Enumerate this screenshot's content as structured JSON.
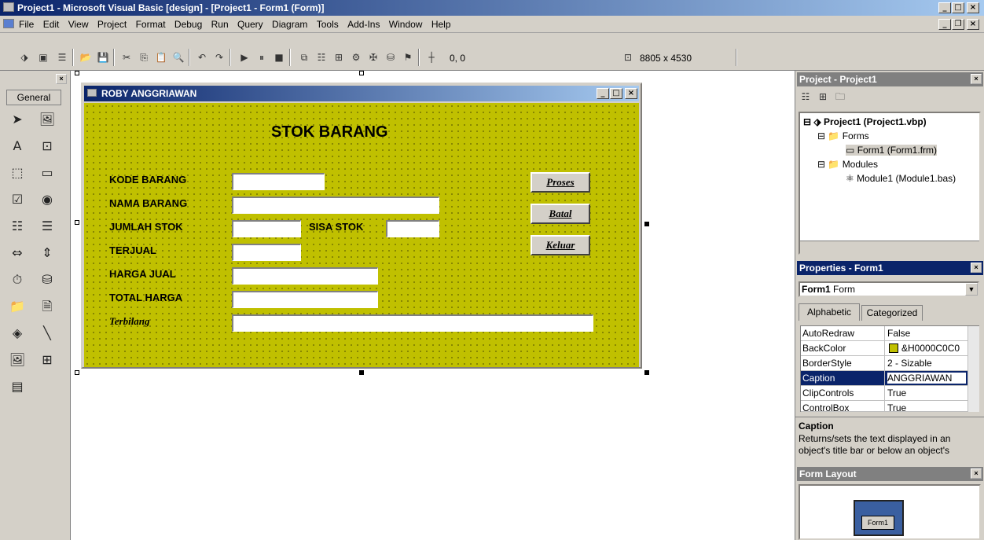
{
  "window": {
    "title": "Project1 - Microsoft Visual Basic [design] - [Project1 - Form1 (Form)]",
    "min": "_",
    "max": "□",
    "close": "×",
    "child_min": "_",
    "child_restore": "❐",
    "child_close": "×"
  },
  "menu": [
    "File",
    "Edit",
    "View",
    "Project",
    "Format",
    "Debug",
    "Run",
    "Query",
    "Diagram",
    "Tools",
    "Add-Ins",
    "Window",
    "Help"
  ],
  "toolbar": {
    "position": "0, 0",
    "size": "8805 x 4530"
  },
  "toolbox": {
    "close": "×",
    "general": "General"
  },
  "form": {
    "caption": "ROBY ANGGRIAWAN",
    "heading": "STOK BARANG",
    "labels": {
      "kode": "KODE BARANG",
      "nama": "NAMA BARANG",
      "jumlah": "JUMLAH STOK",
      "sisa": "SISA STOK",
      "terjual": "TERJUAL",
      "harga": "HARGA JUAL",
      "total": "TOTAL HARGA",
      "terbilang": "Terbilang"
    },
    "buttons": {
      "proses": "Proses",
      "batal": "Batal",
      "keluar": "Keluar"
    }
  },
  "project": {
    "title": "Project - Project1",
    "root": "Project1 (Project1.vbp)",
    "forms_folder": "Forms",
    "form_file": "Form1 (Form1.frm)",
    "modules_folder": "Modules",
    "module_file": "Module1 (Module1.bas)"
  },
  "properties": {
    "title": "Properties - Form1",
    "object_name": "Form1",
    "object_type": "Form",
    "tab_alpha": "Alphabetic",
    "tab_cat": "Categorized",
    "rows": [
      {
        "name": "AutoRedraw",
        "value": "False"
      },
      {
        "name": "BackColor",
        "value": "&H0000C0C0"
      },
      {
        "name": "BorderStyle",
        "value": "2 - Sizable"
      },
      {
        "name": "Caption",
        "value": "ANGGRIAWAN"
      },
      {
        "name": "ClipControls",
        "value": "True"
      },
      {
        "name": "ControlBox",
        "value": "True"
      }
    ],
    "desc_title": "Caption",
    "desc_text": "Returns/sets the text displayed in an object's title bar or below an object's"
  },
  "form_layout": {
    "title": "Form Layout",
    "preview_label": "Form1"
  },
  "colors": {
    "form_back": "#c0c000",
    "title_active": "#0a246a"
  }
}
